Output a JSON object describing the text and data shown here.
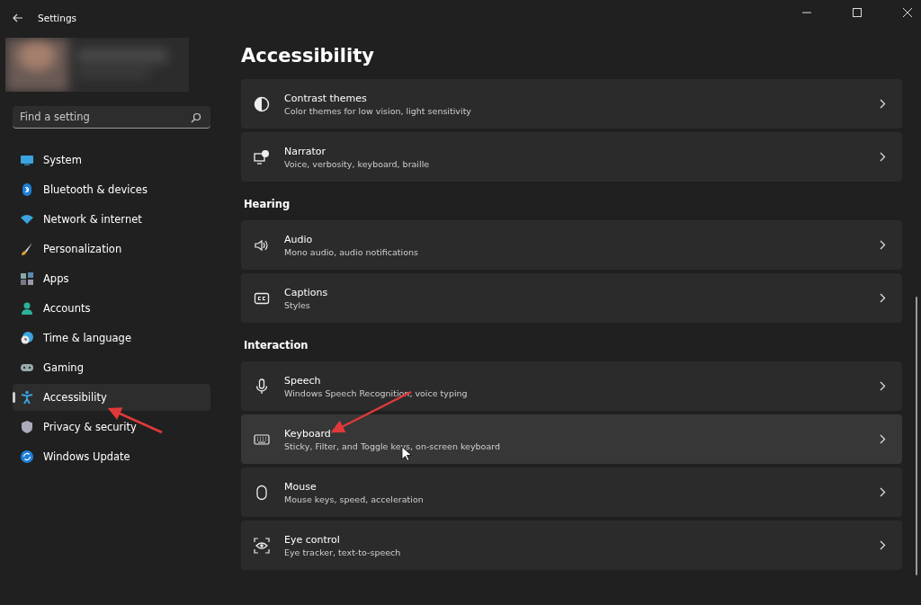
{
  "window": {
    "title": "Settings"
  },
  "search": {
    "placeholder": "Find a setting"
  },
  "sidebar": {
    "items": [
      {
        "label": "System",
        "selected": false
      },
      {
        "label": "Bluetooth & devices",
        "selected": false
      },
      {
        "label": "Network & internet",
        "selected": false
      },
      {
        "label": "Personalization",
        "selected": false
      },
      {
        "label": "Apps",
        "selected": false
      },
      {
        "label": "Accounts",
        "selected": false
      },
      {
        "label": "Time & language",
        "selected": false
      },
      {
        "label": "Gaming",
        "selected": false
      },
      {
        "label": "Accessibility",
        "selected": true
      },
      {
        "label": "Privacy & security",
        "selected": false
      },
      {
        "label": "Windows Update",
        "selected": false
      }
    ]
  },
  "page_title": "Accessibility",
  "sections": [
    {
      "items": [
        {
          "title": "Contrast themes",
          "subtitle": "Color themes for low vision, light sensitivity",
          "hovered": false
        },
        {
          "title": "Narrator",
          "subtitle": "Voice, verbosity, keyboard, braille",
          "hovered": false
        }
      ]
    },
    {
      "heading": "Hearing",
      "items": [
        {
          "title": "Audio",
          "subtitle": "Mono audio, audio notifications",
          "hovered": false
        },
        {
          "title": "Captions",
          "subtitle": "Styles",
          "hovered": false
        }
      ]
    },
    {
      "heading": "Interaction",
      "items": [
        {
          "title": "Speech",
          "subtitle": "Windows Speech Recognition, voice typing",
          "hovered": false
        },
        {
          "title": "Keyboard",
          "subtitle": "Sticky, Filter, and Toggle keys, on-screen keyboard",
          "hovered": true
        },
        {
          "title": "Mouse",
          "subtitle": "Mouse keys, speed, acceleration",
          "hovered": false
        },
        {
          "title": "Eye control",
          "subtitle": "Eye tracker, text-to-speech",
          "hovered": false
        }
      ]
    }
  ]
}
